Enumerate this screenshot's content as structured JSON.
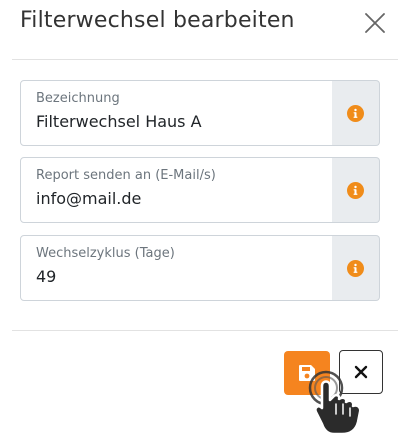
{
  "dialog": {
    "title": "Filterwechsel bearbeiten",
    "close_icon": "close-icon"
  },
  "fields": [
    {
      "label": "Bezeichnung",
      "value": "Filterwechsel Haus A",
      "icon": "info-icon"
    },
    {
      "label": "Report senden an (E-Mail/s)",
      "value": "info@mail.de",
      "icon": "info-icon"
    },
    {
      "label": "Wechselzyklus (Tage)",
      "value": "49",
      "icon": "info-icon"
    }
  ],
  "footer": {
    "save_icon": "save-icon",
    "cancel_icon": "close-icon"
  },
  "colors": {
    "accent": "#f5841f",
    "info_icon": "#f08c1a",
    "addon_bg": "#e9ecef"
  }
}
